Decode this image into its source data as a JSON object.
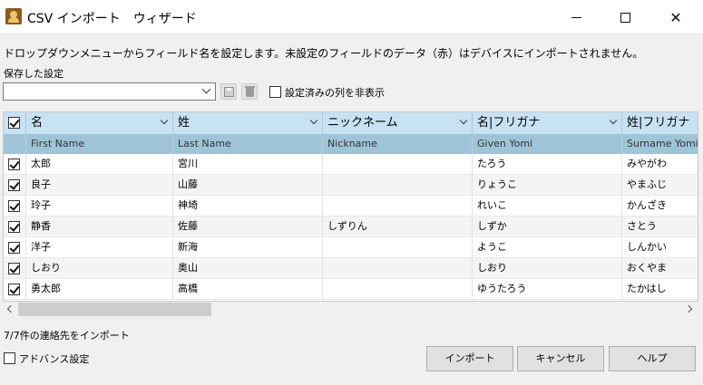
{
  "window": {
    "title": "CSV インポート　ウィザード"
  },
  "instruction": "ドロップダウンメニューからフィールド名を設定します。未設定のフィールドのデータ（赤）はデバイスにインポートされません。",
  "saved_settings": {
    "label": "保存した設定",
    "value": "",
    "hide_columns_label": "設定済みの列を非表示",
    "hide_columns_checked": false
  },
  "grid": {
    "header_all_checked": true,
    "columns": [
      {
        "field": "名",
        "source": "First Name"
      },
      {
        "field": "姓",
        "source": "Last Name"
      },
      {
        "field": "ニックネーム",
        "source": "Nickname"
      },
      {
        "field": "名|フリガナ",
        "source": "Given Yomi"
      },
      {
        "field": "姓|フリガナ",
        "source": "Surname Yomi"
      }
    ],
    "rows": [
      {
        "checked": true,
        "cells": [
          "太郎",
          "宮川",
          "",
          "たろう",
          "みやがわ"
        ]
      },
      {
        "checked": true,
        "cells": [
          "良子",
          "山藤",
          "",
          "りょうこ",
          "やまふじ"
        ]
      },
      {
        "checked": true,
        "cells": [
          "玲子",
          "神埼",
          "",
          "れいこ",
          "かんざき"
        ]
      },
      {
        "checked": true,
        "cells": [
          "静香",
          "佐藤",
          "しずりん",
          "しずか",
          "さとう"
        ]
      },
      {
        "checked": true,
        "cells": [
          "洋子",
          "新海",
          "",
          "ようこ",
          "しんかい"
        ]
      },
      {
        "checked": true,
        "cells": [
          "しおり",
          "奥山",
          "",
          "しおり",
          "おくやま"
        ]
      },
      {
        "checked": true,
        "cells": [
          "勇太郎",
          "高橋",
          "",
          "ゆうたろう",
          "たかはし"
        ]
      }
    ]
  },
  "import_count": "7/7件の連絡先をインポート",
  "advanced": {
    "label": "アドバンス設定",
    "checked": false
  },
  "buttons": {
    "import": "インポート",
    "cancel": "キャンセル",
    "help": "ヘルプ"
  }
}
